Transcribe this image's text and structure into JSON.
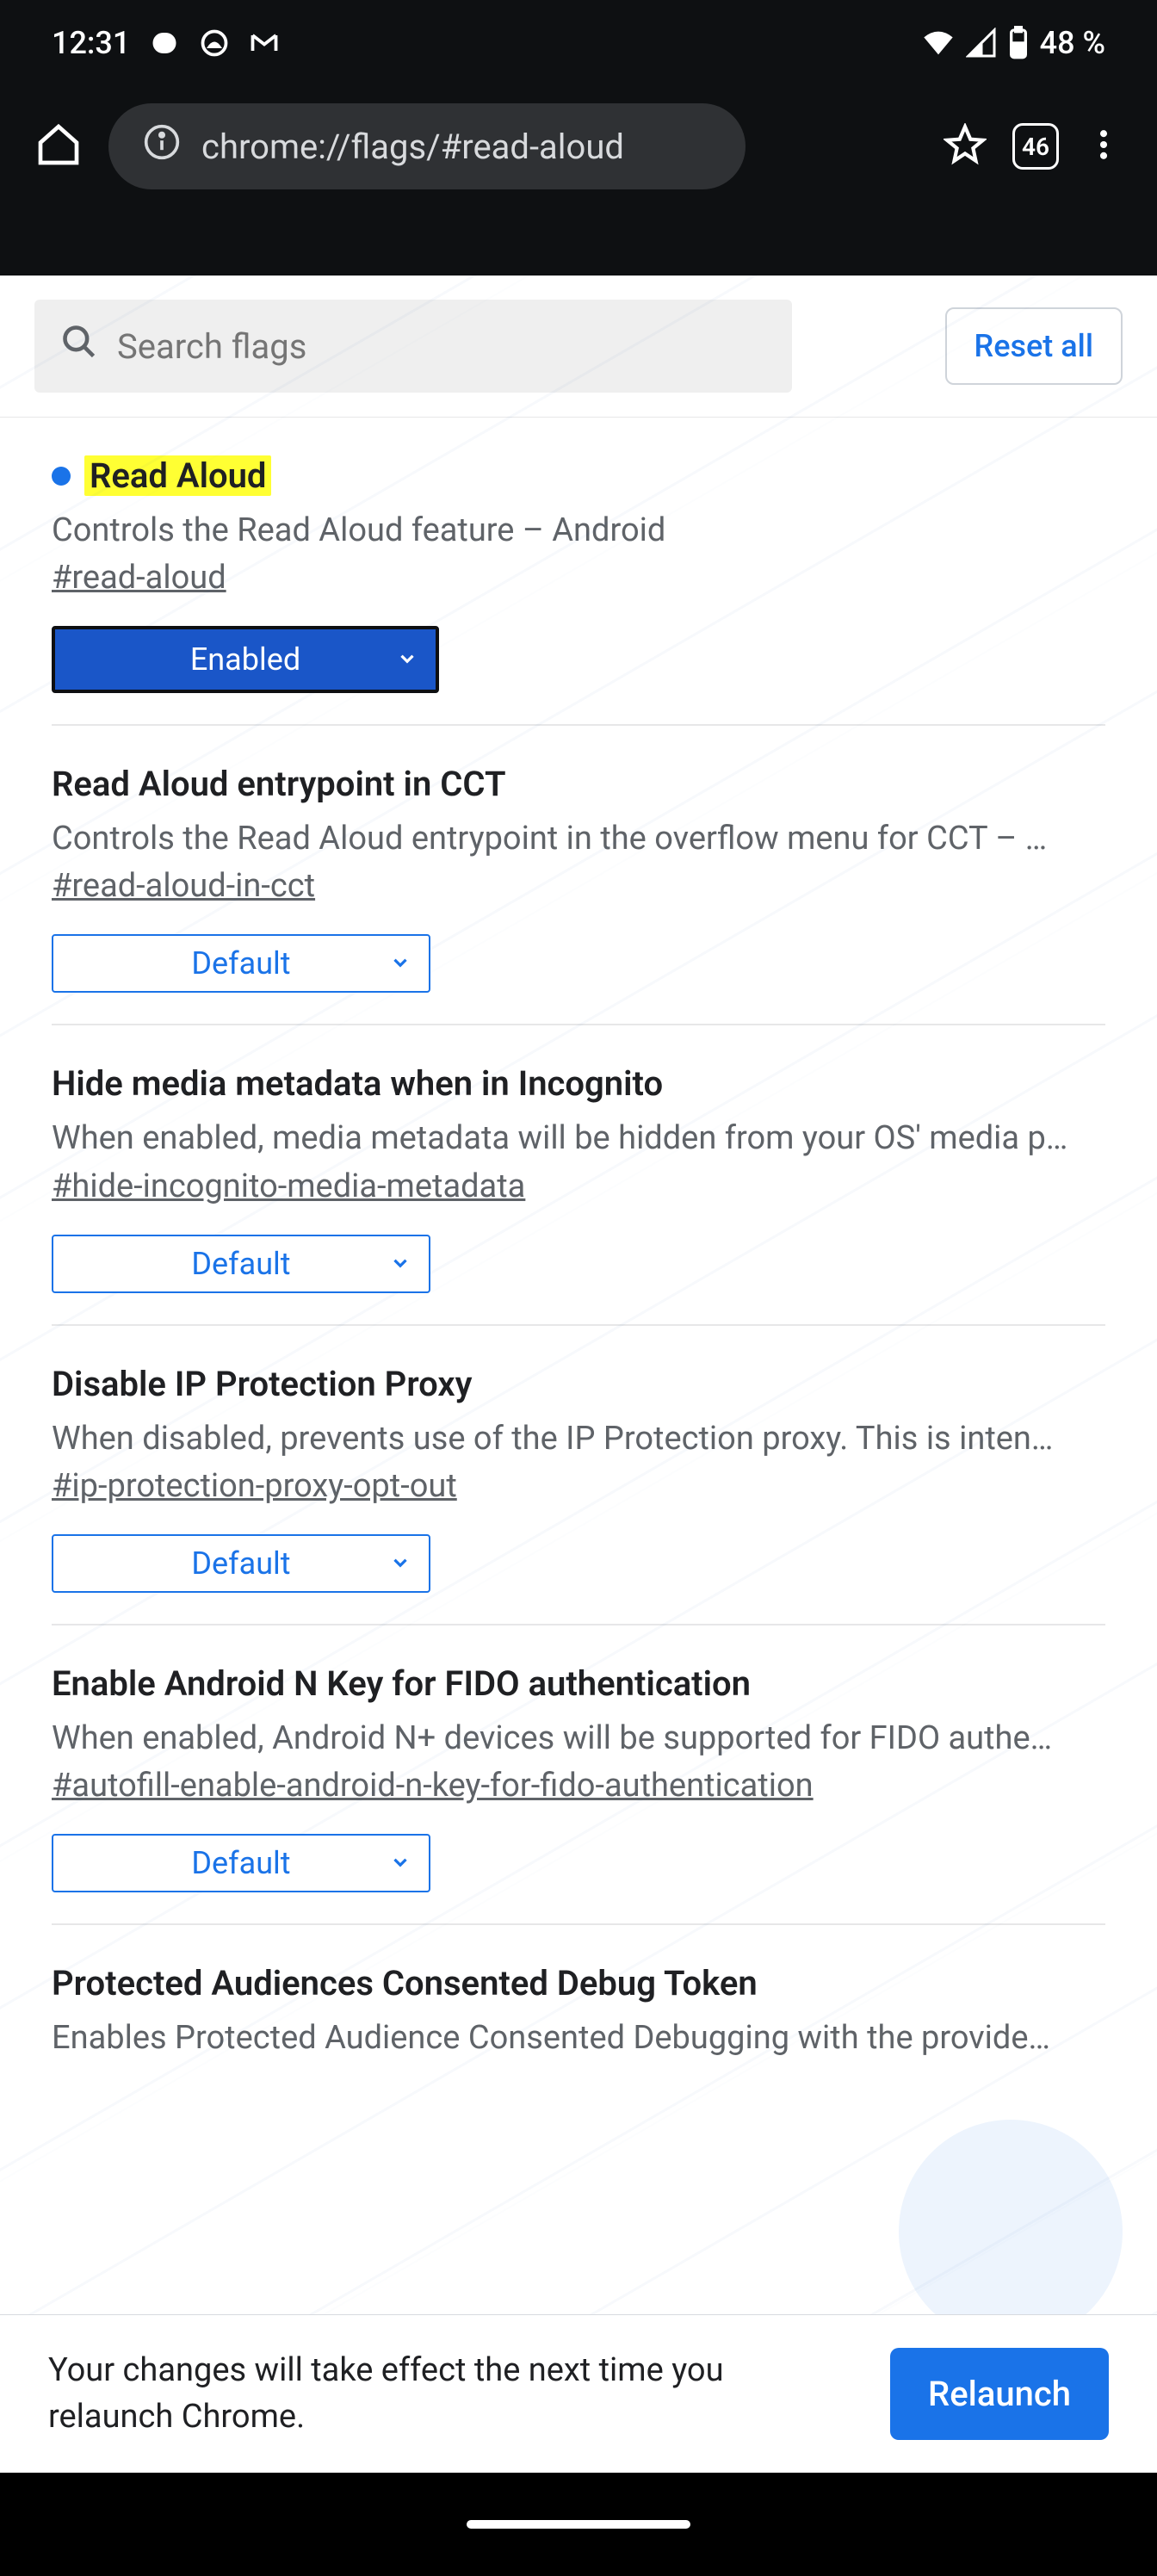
{
  "status": {
    "time": "12:31",
    "battery_percent": "48 %"
  },
  "browser": {
    "url": "chrome://flags/#read-aloud",
    "tab_count": "46"
  },
  "search": {
    "placeholder": "Search flags",
    "reset_label": "Reset all"
  },
  "flags": [
    {
      "title": "Read Aloud",
      "highlighted": true,
      "dot": true,
      "desc": "Controls the Read Aloud feature – Android",
      "anchor": "#read-aloud",
      "value": "Enabled",
      "primary": true
    },
    {
      "title": "Read Aloud entrypoint in CCT",
      "desc": "Controls the Read Aloud entrypoint in the overflow menu for CCT – …",
      "anchor": "#read-aloud-in-cct",
      "value": "Default"
    },
    {
      "title": "Hide media metadata when in Incognito",
      "desc": "When enabled, media metadata will be hidden from your OS' media p…",
      "anchor": "#hide-incognito-media-metadata",
      "value": "Default"
    },
    {
      "title": "Disable IP Protection Proxy",
      "desc": "When disabled, prevents use of the IP Protection proxy. This is inten…",
      "anchor": "#ip-protection-proxy-opt-out",
      "value": "Default"
    },
    {
      "title": "Enable Android N Key for FIDO authentication",
      "desc": "When enabled, Android N+ devices will be supported for FIDO authe…",
      "anchor": "#autofill-enable-android-n-key-for-fido-authentication",
      "value": "Default"
    },
    {
      "title": "Protected Audiences Consented Debug Token",
      "desc": "Enables Protected Audience Consented Debugging with the provide…",
      "anchor": "",
      "value": "",
      "truncated": true
    }
  ],
  "relaunch": {
    "message": "Your changes will take effect the next time you relaunch Chrome.",
    "button": "Relaunch"
  }
}
